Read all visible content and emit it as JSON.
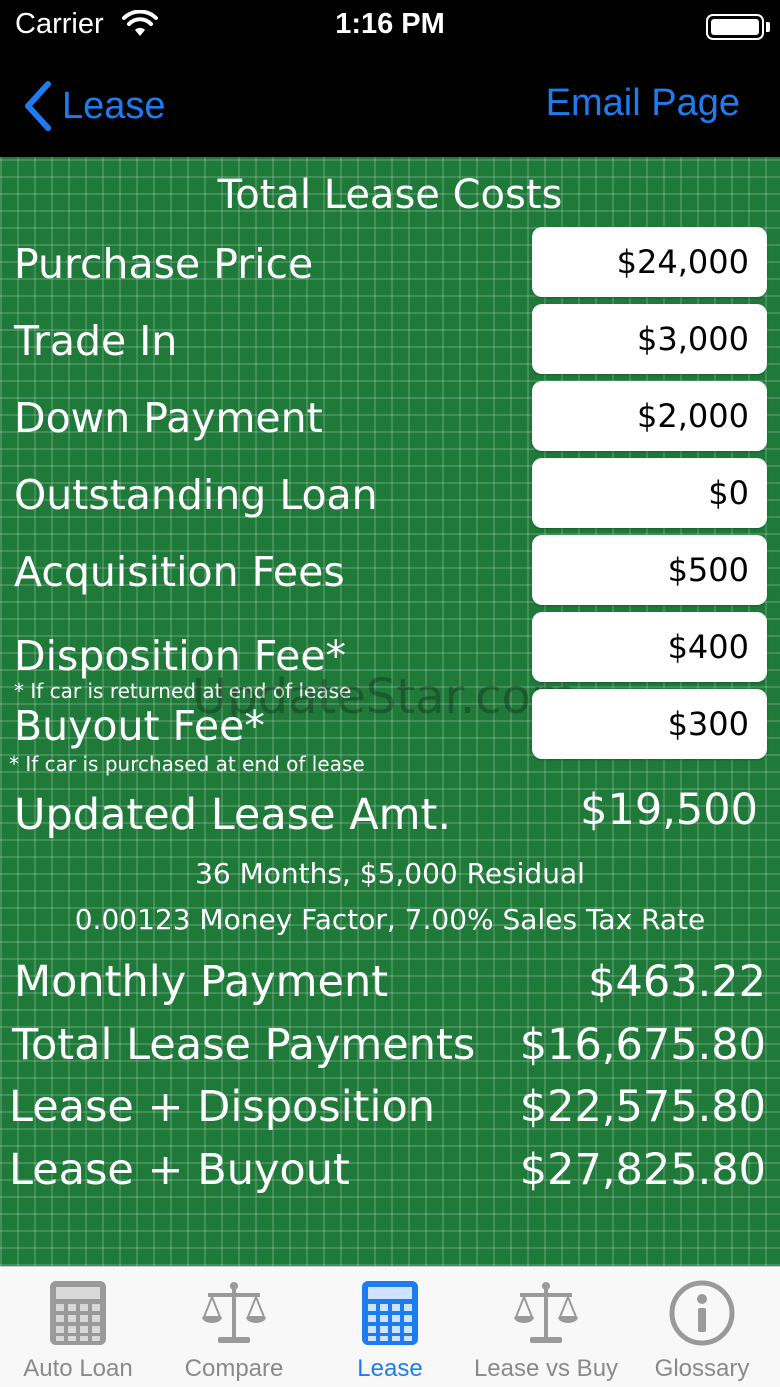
{
  "status_bar": {
    "carrier": "Carrier",
    "time": "1:16 PM"
  },
  "nav": {
    "back_label": "Lease",
    "action_label": "Email Page"
  },
  "section_title": "Total Lease Costs",
  "inputs": [
    {
      "label": "Purchase Price",
      "value": "$24,000"
    },
    {
      "label": "Trade In",
      "value": "$3,000"
    },
    {
      "label": "Down Payment",
      "value": "$2,000"
    },
    {
      "label": "Outstanding Loan",
      "value": "$0"
    },
    {
      "label": "Acquisition Fees",
      "value": "$500"
    },
    {
      "label": "Disposition Fee*",
      "value": "$400",
      "note": "* If car is returned at end of lease"
    },
    {
      "label": "Buyout Fee*",
      "value": "$300",
      "note": "* If car is purchased at end of lease"
    }
  ],
  "watermark": "UpdateStar.com",
  "updated_lease": {
    "label": "Updated Lease Amt.",
    "value": "$19,500"
  },
  "terms_line1": "36 Months, $5,000 Residual",
  "terms_line2": "0.00123 Money Factor, 7.00% Sales Tax Rate",
  "results": [
    {
      "label": "Monthly Payment",
      "value": "$463.22"
    },
    {
      "label": "Total Lease Payments",
      "value": "$16,675.80"
    },
    {
      "label": "Lease + Disposition",
      "value": "$22,575.80"
    },
    {
      "label": "Lease + Buyout",
      "value": "$27,825.80"
    }
  ],
  "tabs": [
    {
      "label": "Auto Loan",
      "icon": "calculator-icon",
      "active": false
    },
    {
      "label": "Compare",
      "icon": "scales-icon",
      "active": false
    },
    {
      "label": "Lease",
      "icon": "calculator-icon",
      "active": true
    },
    {
      "label": "Lease vs Buy",
      "icon": "scales-icon",
      "active": false
    },
    {
      "label": "Glossary",
      "icon": "info-icon",
      "active": false
    }
  ],
  "colors": {
    "background_green": "#1f7a3a",
    "accent_blue": "#1e7cf2",
    "tab_inactive": "#8a8a8a"
  }
}
